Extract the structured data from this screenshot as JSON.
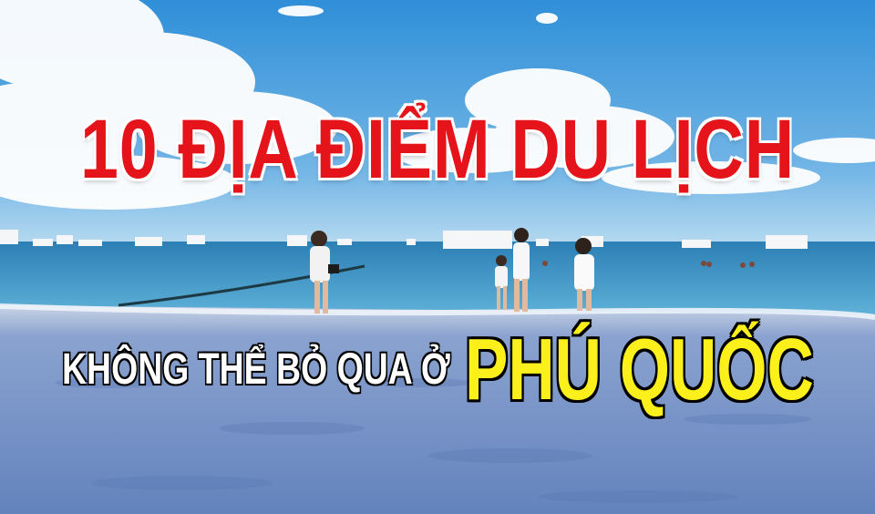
{
  "headline": {
    "text": "10 ĐỊA ĐIỂM DU LỊCH"
  },
  "subline": {
    "lead": "KHÔNG THỂ BỎ QUA Ở",
    "place": "PHÚ QUỐC"
  },
  "colors": {
    "sky_top": "#2f8fd8",
    "sky_bottom": "#a9d3ef",
    "sea": "#3f92c2",
    "sand": "#6f8fc2",
    "headline": "#e5141b",
    "place": "#fbef1c"
  }
}
